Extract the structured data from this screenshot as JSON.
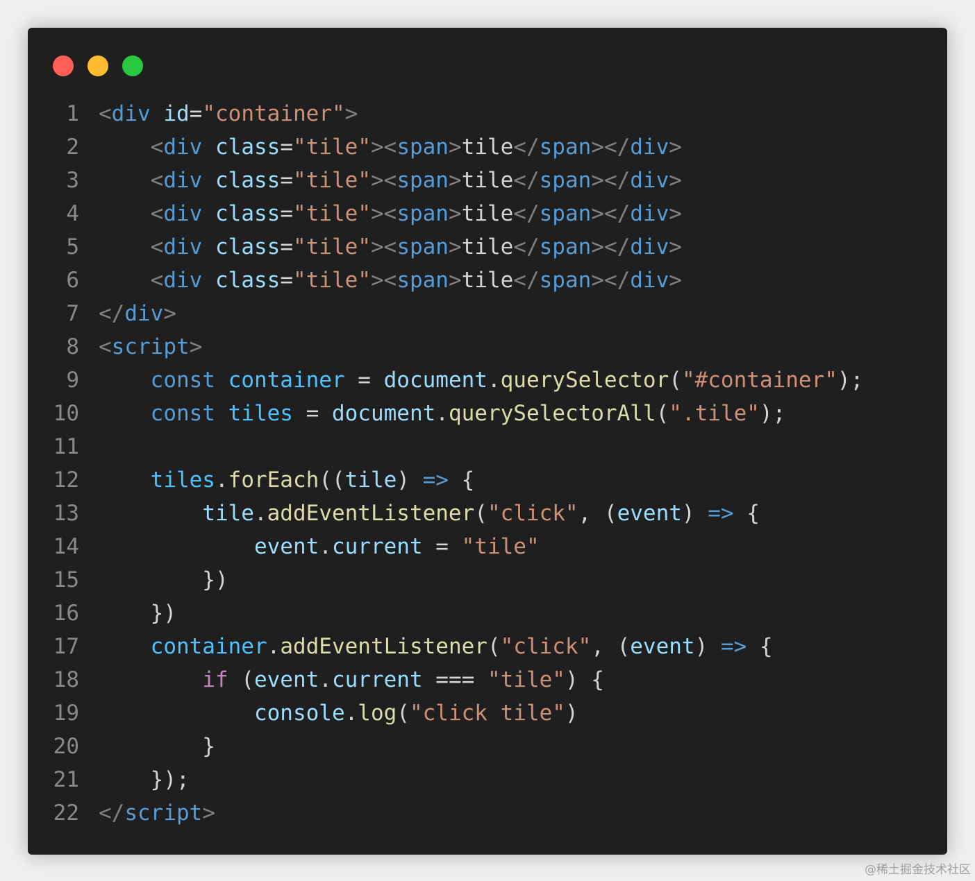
{
  "window": {
    "controls": {
      "close": {
        "icon": "close-dot-icon",
        "color": "#ff5f57"
      },
      "minimize": {
        "icon": "minimize-dot-icon",
        "color": "#febc2e"
      },
      "maximize": {
        "icon": "maximize-dot-icon",
        "color": "#28c840"
      }
    }
  },
  "code": {
    "lines": [
      {
        "n": "1",
        "tokens": [
          [
            "tok-punc",
            "<"
          ],
          [
            "tok-blue",
            "div"
          ],
          [
            "tok-plain",
            " "
          ],
          [
            "tok-attr",
            "id"
          ],
          [
            "tok-plain",
            "="
          ],
          [
            "tok-str",
            "\"container\""
          ],
          [
            "tok-punc",
            ">"
          ]
        ]
      },
      {
        "n": "2",
        "tokens": [
          [
            "tok-plain",
            "    "
          ],
          [
            "tok-punc",
            "<"
          ],
          [
            "tok-blue",
            "div"
          ],
          [
            "tok-plain",
            " "
          ],
          [
            "tok-attr",
            "class"
          ],
          [
            "tok-plain",
            "="
          ],
          [
            "tok-str",
            "\"tile\""
          ],
          [
            "tok-punc",
            "><"
          ],
          [
            "tok-blue",
            "span"
          ],
          [
            "tok-punc",
            ">"
          ],
          [
            "tok-plain",
            "tile"
          ],
          [
            "tok-punc",
            "</"
          ],
          [
            "tok-blue",
            "span"
          ],
          [
            "tok-punc",
            "></"
          ],
          [
            "tok-blue",
            "div"
          ],
          [
            "tok-punc",
            ">"
          ]
        ]
      },
      {
        "n": "3",
        "tokens": [
          [
            "tok-plain",
            "    "
          ],
          [
            "tok-punc",
            "<"
          ],
          [
            "tok-blue",
            "div"
          ],
          [
            "tok-plain",
            " "
          ],
          [
            "tok-attr",
            "class"
          ],
          [
            "tok-plain",
            "="
          ],
          [
            "tok-str",
            "\"tile\""
          ],
          [
            "tok-punc",
            "><"
          ],
          [
            "tok-blue",
            "span"
          ],
          [
            "tok-punc",
            ">"
          ],
          [
            "tok-plain",
            "tile"
          ],
          [
            "tok-punc",
            "</"
          ],
          [
            "tok-blue",
            "span"
          ],
          [
            "tok-punc",
            "></"
          ],
          [
            "tok-blue",
            "div"
          ],
          [
            "tok-punc",
            ">"
          ]
        ]
      },
      {
        "n": "4",
        "tokens": [
          [
            "tok-plain",
            "    "
          ],
          [
            "tok-punc",
            "<"
          ],
          [
            "tok-blue",
            "div"
          ],
          [
            "tok-plain",
            " "
          ],
          [
            "tok-attr",
            "class"
          ],
          [
            "tok-plain",
            "="
          ],
          [
            "tok-str",
            "\"tile\""
          ],
          [
            "tok-punc",
            "><"
          ],
          [
            "tok-blue",
            "span"
          ],
          [
            "tok-punc",
            ">"
          ],
          [
            "tok-plain",
            "tile"
          ],
          [
            "tok-punc",
            "</"
          ],
          [
            "tok-blue",
            "span"
          ],
          [
            "tok-punc",
            "></"
          ],
          [
            "tok-blue",
            "div"
          ],
          [
            "tok-punc",
            ">"
          ]
        ]
      },
      {
        "n": "5",
        "tokens": [
          [
            "tok-plain",
            "    "
          ],
          [
            "tok-punc",
            "<"
          ],
          [
            "tok-blue",
            "div"
          ],
          [
            "tok-plain",
            " "
          ],
          [
            "tok-attr",
            "class"
          ],
          [
            "tok-plain",
            "="
          ],
          [
            "tok-str",
            "\"tile\""
          ],
          [
            "tok-punc",
            "><"
          ],
          [
            "tok-blue",
            "span"
          ],
          [
            "tok-punc",
            ">"
          ],
          [
            "tok-plain",
            "tile"
          ],
          [
            "tok-punc",
            "</"
          ],
          [
            "tok-blue",
            "span"
          ],
          [
            "tok-punc",
            "></"
          ],
          [
            "tok-blue",
            "div"
          ],
          [
            "tok-punc",
            ">"
          ]
        ]
      },
      {
        "n": "6",
        "tokens": [
          [
            "tok-plain",
            "    "
          ],
          [
            "tok-punc",
            "<"
          ],
          [
            "tok-blue",
            "div"
          ],
          [
            "tok-plain",
            " "
          ],
          [
            "tok-attr",
            "class"
          ],
          [
            "tok-plain",
            "="
          ],
          [
            "tok-str",
            "\"tile\""
          ],
          [
            "tok-punc",
            "><"
          ],
          [
            "tok-blue",
            "span"
          ],
          [
            "tok-punc",
            ">"
          ],
          [
            "tok-plain",
            "tile"
          ],
          [
            "tok-punc",
            "</"
          ],
          [
            "tok-blue",
            "span"
          ],
          [
            "tok-punc",
            "></"
          ],
          [
            "tok-blue",
            "div"
          ],
          [
            "tok-punc",
            ">"
          ]
        ]
      },
      {
        "n": "7",
        "tokens": [
          [
            "tok-punc",
            "</"
          ],
          [
            "tok-blue",
            "div"
          ],
          [
            "tok-punc",
            ">"
          ]
        ]
      },
      {
        "n": "8",
        "tokens": [
          [
            "tok-punc",
            "<"
          ],
          [
            "tok-blue",
            "script"
          ],
          [
            "tok-punc",
            ">"
          ]
        ]
      },
      {
        "n": "9",
        "tokens": [
          [
            "tok-plain",
            "    "
          ],
          [
            "tok-blue",
            "const"
          ],
          [
            "tok-plain",
            " "
          ],
          [
            "tok-var",
            "container"
          ],
          [
            "tok-plain",
            " = "
          ],
          [
            "tok-attr",
            "document"
          ],
          [
            "tok-plain",
            "."
          ],
          [
            "tok-fn",
            "querySelector"
          ],
          [
            "tok-plain",
            "("
          ],
          [
            "tok-str",
            "\"#container\""
          ],
          [
            "tok-plain",
            ");"
          ]
        ]
      },
      {
        "n": "10",
        "tokens": [
          [
            "tok-plain",
            "    "
          ],
          [
            "tok-blue",
            "const"
          ],
          [
            "tok-plain",
            " "
          ],
          [
            "tok-var",
            "tiles"
          ],
          [
            "tok-plain",
            " = "
          ],
          [
            "tok-attr",
            "document"
          ],
          [
            "tok-plain",
            "."
          ],
          [
            "tok-fn",
            "querySelectorAll"
          ],
          [
            "tok-plain",
            "("
          ],
          [
            "tok-str",
            "\".tile\""
          ],
          [
            "tok-plain",
            ");"
          ]
        ]
      },
      {
        "n": "11",
        "tokens": []
      },
      {
        "n": "12",
        "tokens": [
          [
            "tok-plain",
            "    "
          ],
          [
            "tok-var",
            "tiles"
          ],
          [
            "tok-plain",
            "."
          ],
          [
            "tok-fn",
            "forEach"
          ],
          [
            "tok-plain",
            "(("
          ],
          [
            "tok-attr",
            "tile"
          ],
          [
            "tok-plain",
            ") "
          ],
          [
            "tok-blue",
            "=>"
          ],
          [
            "tok-plain",
            " {"
          ]
        ]
      },
      {
        "n": "13",
        "tokens": [
          [
            "tok-plain",
            "        "
          ],
          [
            "tok-attr",
            "tile"
          ],
          [
            "tok-plain",
            "."
          ],
          [
            "tok-fn",
            "addEventListener"
          ],
          [
            "tok-plain",
            "("
          ],
          [
            "tok-str",
            "\"click\""
          ],
          [
            "tok-plain",
            ", ("
          ],
          [
            "tok-attr",
            "event"
          ],
          [
            "tok-plain",
            ") "
          ],
          [
            "tok-blue",
            "=>"
          ],
          [
            "tok-plain",
            " {"
          ]
        ]
      },
      {
        "n": "14",
        "tokens": [
          [
            "tok-plain",
            "            "
          ],
          [
            "tok-attr",
            "event"
          ],
          [
            "tok-plain",
            "."
          ],
          [
            "tok-attr",
            "current"
          ],
          [
            "tok-plain",
            " = "
          ],
          [
            "tok-str",
            "\"tile\""
          ]
        ]
      },
      {
        "n": "15",
        "tokens": [
          [
            "tok-plain",
            "        })"
          ]
        ]
      },
      {
        "n": "16",
        "tokens": [
          [
            "tok-plain",
            "    })"
          ]
        ]
      },
      {
        "n": "17",
        "tokens": [
          [
            "tok-plain",
            "    "
          ],
          [
            "tok-var",
            "container"
          ],
          [
            "tok-plain",
            "."
          ],
          [
            "tok-fn",
            "addEventListener"
          ],
          [
            "tok-plain",
            "("
          ],
          [
            "tok-str",
            "\"click\""
          ],
          [
            "tok-plain",
            ", ("
          ],
          [
            "tok-attr",
            "event"
          ],
          [
            "tok-plain",
            ") "
          ],
          [
            "tok-blue",
            "=>"
          ],
          [
            "tok-plain",
            " {"
          ]
        ]
      },
      {
        "n": "18",
        "tokens": [
          [
            "tok-plain",
            "        "
          ],
          [
            "tok-kw",
            "if"
          ],
          [
            "tok-plain",
            " ("
          ],
          [
            "tok-attr",
            "event"
          ],
          [
            "tok-plain",
            "."
          ],
          [
            "tok-attr",
            "current"
          ],
          [
            "tok-plain",
            " === "
          ],
          [
            "tok-str",
            "\"tile\""
          ],
          [
            "tok-plain",
            ") {"
          ]
        ]
      },
      {
        "n": "19",
        "tokens": [
          [
            "tok-plain",
            "            "
          ],
          [
            "tok-attr",
            "console"
          ],
          [
            "tok-plain",
            "."
          ],
          [
            "tok-fn",
            "log"
          ],
          [
            "tok-plain",
            "("
          ],
          [
            "tok-str",
            "\"click tile\""
          ],
          [
            "tok-plain",
            ")"
          ]
        ]
      },
      {
        "n": "20",
        "tokens": [
          [
            "tok-plain",
            "        }"
          ]
        ]
      },
      {
        "n": "21",
        "tokens": [
          [
            "tok-plain",
            "    });"
          ]
        ]
      },
      {
        "n": "22",
        "tokens": [
          [
            "tok-punc",
            "</"
          ],
          [
            "tok-blue",
            "script"
          ],
          [
            "tok-punc",
            ">"
          ]
        ]
      }
    ]
  },
  "watermark": "@稀土掘金技术社区"
}
